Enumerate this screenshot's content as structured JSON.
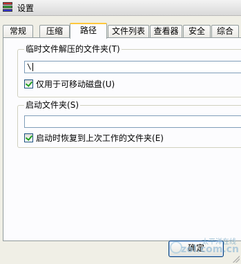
{
  "window": {
    "title": "设置"
  },
  "tabs": [
    {
      "label": "常规"
    },
    {
      "label": "压缩"
    },
    {
      "label": "路径"
    },
    {
      "label": "文件列表"
    },
    {
      "label": "查看器"
    },
    {
      "label": "安全"
    },
    {
      "label": "综合"
    }
  ],
  "active_tab": "路径",
  "temp_folder": {
    "group_title": "临时文件解压的文件夹",
    "accel": "(T)",
    "value": "\\",
    "removable_checkbox": {
      "label": "仅用于可移动磁盘",
      "accel": "(U)",
      "checked": true
    }
  },
  "start_folder": {
    "group_title": "启动文件夹",
    "accel": "(S)",
    "value": "",
    "restore_checkbox": {
      "label": "启动时恢复到上次工作的文件夹",
      "accel": "(E)",
      "checked": true
    }
  },
  "buttons": {
    "ok_label": "确定"
  },
  "watermark": {
    "line1": "太平洋在线",
    "line2": "zol.com.cn"
  },
  "icons": {
    "app": "archive-app-icon",
    "checkbox_mark": "checkmark-icon"
  },
  "colors": {
    "active_tab_highlight": "#ffc83c",
    "check_green": "#21a121",
    "field_border": "#7f9db9"
  }
}
